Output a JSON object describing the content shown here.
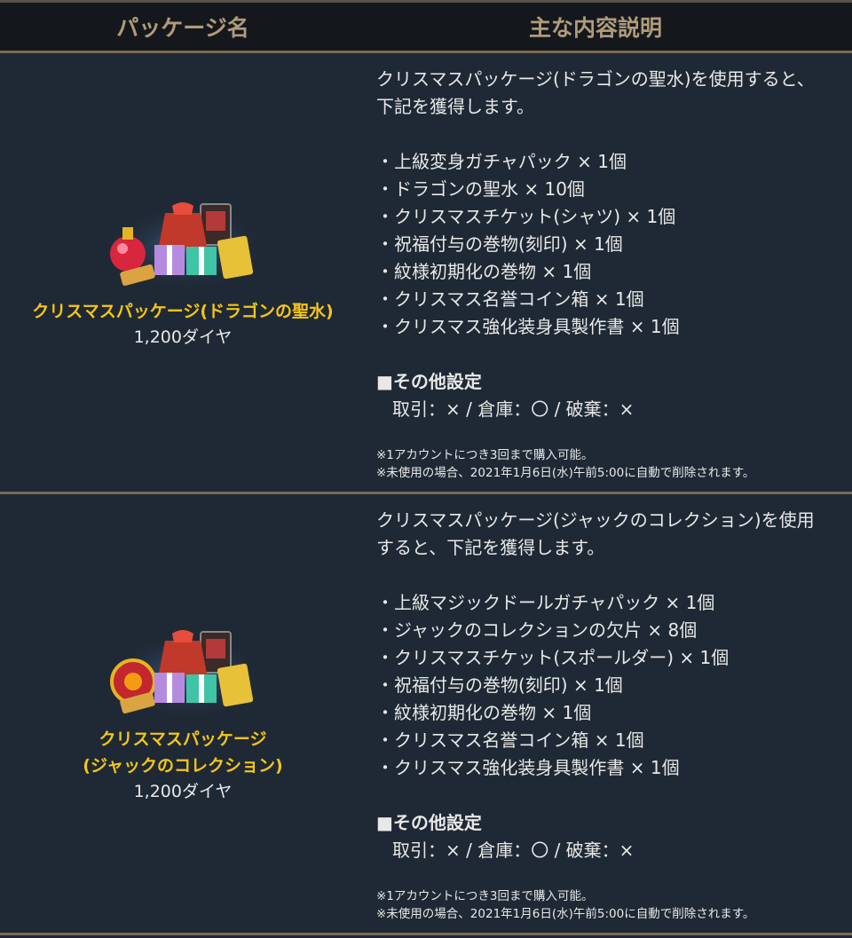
{
  "header": {
    "col_package": "パッケージ名",
    "col_contents": "主な内容説明"
  },
  "packages": [
    {
      "name_line1": "クリスマスパッケージ(ドラゴンの聖水)",
      "name_line2": "",
      "price": "1,200ダイヤ",
      "desc_line1": "クリスマスパッケージ(ドラゴンの聖水)を使用すると、",
      "desc_line2": "下記を獲得します。",
      "items": [
        "・上級変身ガチャパック × 1個",
        "・ドラゴンの聖水 × 10個",
        "・クリスマスチケット(シャツ) × 1個",
        "・祝福付与の巻物(刻印) × 1個",
        "・紋様初期化の巻物 × 1個",
        "・クリスマス名誉コイン箱 × 1個",
        "・クリスマス強化装身具製作書 × 1個"
      ],
      "other_title": "■その他設定",
      "other_value": "取引：× / 倉庫：〇 / 破棄：×",
      "note1": "※1アカウントにつき3回まで購入可能。",
      "note2": "※未使用の場合、2021年1月6日(水)午前5:00に自動で削除されます。"
    },
    {
      "name_line1": "クリスマスパッケージ",
      "name_line2": "(ジャックのコレクション)",
      "price": "1,200ダイヤ",
      "desc_line1": "クリスマスパッケージ(ジャックのコレクション)を使用",
      "desc_line2": "すると、下記を獲得します。",
      "items": [
        "・上級マジックドールガチャパック × 1個",
        "・ジャックのコレクションの欠片 × 8個",
        "・クリスマスチケット(スポールダー) × 1個",
        "・祝福付与の巻物(刻印) × 1個",
        "・紋様初期化の巻物 × 1個",
        "・クリスマス名誉コイン箱 × 1個",
        "・クリスマス強化装身具製作書 × 1個"
      ],
      "other_title": "■その他設定",
      "other_value": "取引：× / 倉庫：〇 / 破棄：×",
      "note1": "※1アカウントにつき3回まで購入可能。",
      "note2": "※未使用の場合、2021年1月6日(水)午前5:00に自動で削除されます。"
    }
  ],
  "colors": {
    "background": "#1e2834",
    "header_bg": "#14181d",
    "header_text": "#b09b7a",
    "divider": "#7b6b53",
    "package_name": "#f5c518"
  },
  "icons": [
    "potion-icon",
    "gift-bag-icon",
    "gift-box-icon",
    "ticket-icon",
    "card-icon",
    "coin-icon"
  ]
}
